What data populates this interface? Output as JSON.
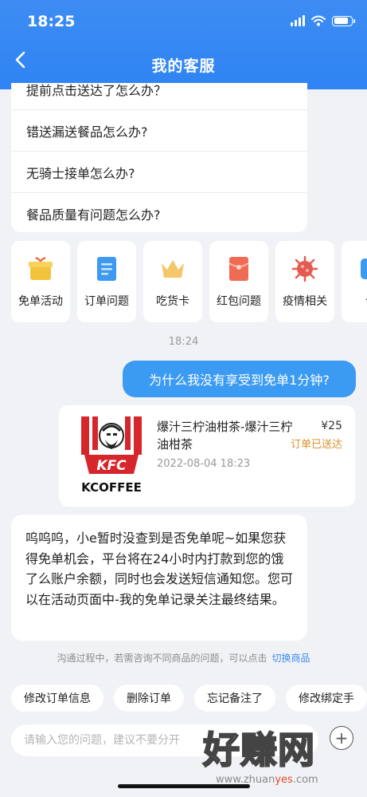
{
  "status_bar": {
    "time": "18:25",
    "battery_level": 0.85
  },
  "header": {
    "title": "我的客服"
  },
  "faq": {
    "items": [
      "提前点击送达了怎么办？",
      "错送漏送餐品怎么办?",
      "无骑士接单怎么办?",
      "餐品质量有问题怎么办?"
    ]
  },
  "shortcuts": [
    {
      "label": "免单活动",
      "icon": "gift-icon",
      "color": "#f4c33d"
    },
    {
      "label": "订单问题",
      "icon": "document-icon",
      "color": "#3d9af0"
    },
    {
      "label": "吃货卡",
      "icon": "crown-icon",
      "color": "#f5c66a"
    },
    {
      "label": "红包问题",
      "icon": "red-envelope-icon",
      "color": "#f06b54"
    },
    {
      "label": "疫情相关",
      "icon": "virus-icon",
      "color": "#e25c4f"
    },
    {
      "label": "合",
      "icon": "partial-icon",
      "color": "#3d9af0"
    }
  ],
  "chat": {
    "time_divider": "18:24",
    "user_message": "为什么我没有享受到免单1分钟?",
    "order": {
      "brand_logo_text": "KFC",
      "brand_sub_text": "KCOFFEE",
      "name": "爆汁三柠油柑茶-爆汁三柠油柑茶",
      "price": "¥25",
      "status": "订单已送达",
      "time": "2022-08-04 18:23"
    },
    "bot_message": "呜呜呜，小e暂时没查到是否免单呢~如果您获得免单机会，平台将在24小时内打款到您的饿了么账户余额，同时也会发送短信通知您。您可以在活动页面中-我的免单记录关注最终结果。"
  },
  "tip": {
    "text": "沟通过程中，若需咨询不同商品的问题，可以点击",
    "link": "切换商品"
  },
  "quick_actions": [
    "修改订单信息",
    "删除订单",
    "忘记备注了",
    "修改绑定手"
  ],
  "input": {
    "placeholder": "请输入您的问题，建议不要分开"
  },
  "watermark": {
    "cn": "好赚网",
    "url_pre": "www.zhuan",
    "url_accent": "yes",
    "url_post": ".com"
  }
}
